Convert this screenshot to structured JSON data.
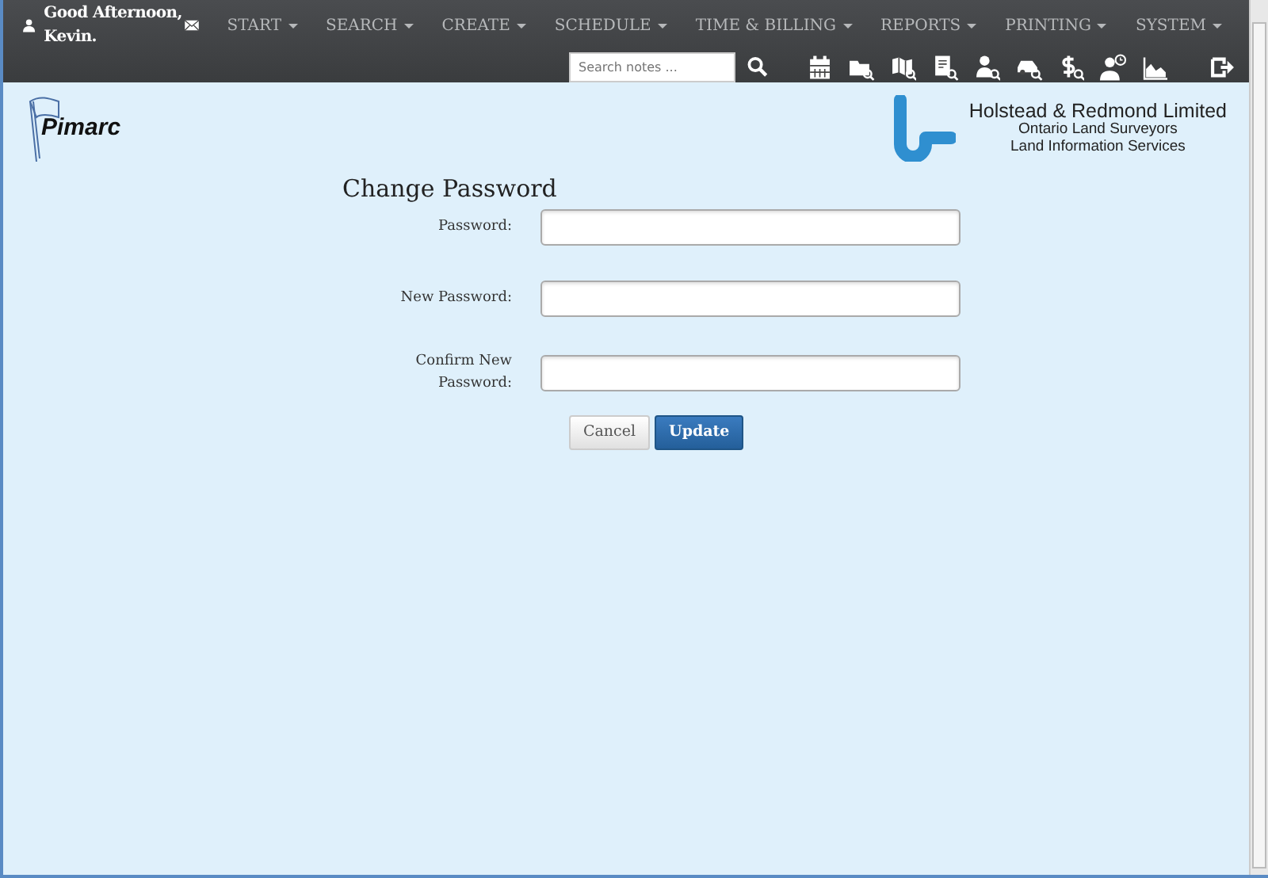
{
  "user_bar": {
    "greeting": "Good Afternoon, Kevin."
  },
  "menu": [
    {
      "label": "START"
    },
    {
      "label": "SEARCH"
    },
    {
      "label": "CREATE"
    },
    {
      "label": "SCHEDULE"
    },
    {
      "label": "TIME & BILLING"
    },
    {
      "label": "REPORTS"
    },
    {
      "label": "PRINTING"
    },
    {
      "label": "SYSTEM"
    }
  ],
  "search": {
    "placeholder": "Search notes ..."
  },
  "logos": {
    "app": "Pimarc",
    "company": "Holstead & Redmond Limited",
    "company_lines": [
      "Ontario Land Surveyors",
      "Land Information Services"
    ]
  },
  "form": {
    "title": "Change Password",
    "fields": [
      {
        "label": "Password:"
      },
      {
        "label": "New Password:"
      },
      {
        "label": "Confirm New Password:"
      }
    ],
    "buttons": [
      {
        "label": "Cancel",
        "kind": "secondary"
      },
      {
        "label": "Update",
        "kind": "primary"
      }
    ]
  }
}
